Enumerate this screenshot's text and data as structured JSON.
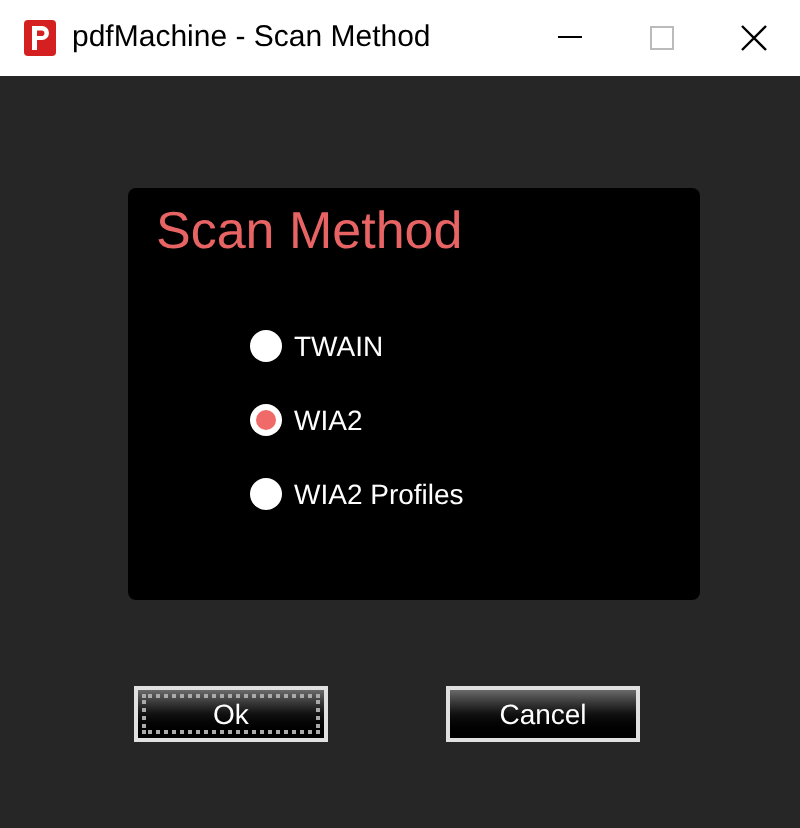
{
  "window": {
    "title": "pdfMachine - Scan Method"
  },
  "panel": {
    "title": "Scan Method"
  },
  "options": [
    {
      "label": "TWAIN",
      "selected": false
    },
    {
      "label": "WIA2",
      "selected": true
    },
    {
      "label": "WIA2 Profiles",
      "selected": false
    }
  ],
  "buttons": [
    {
      "label": "Ok",
      "focused": true
    },
    {
      "label": "Cancel",
      "focused": false
    }
  ]
}
